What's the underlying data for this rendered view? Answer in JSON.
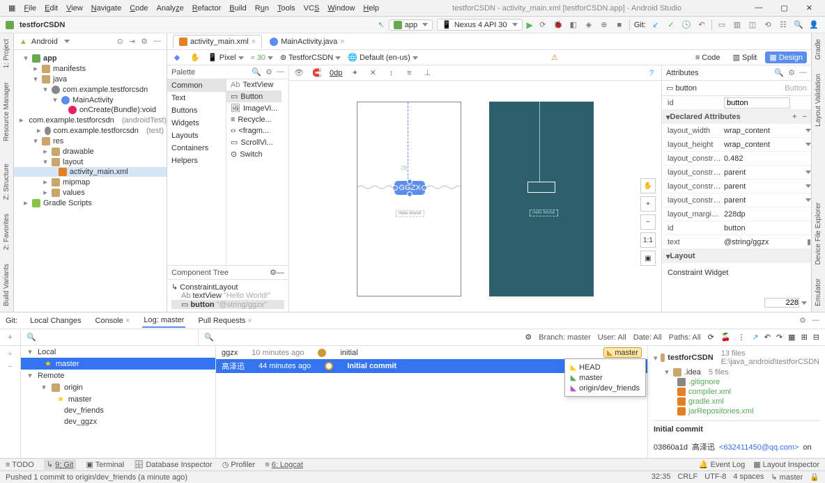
{
  "window": {
    "title": "testforCSDN - activity_main.xml [testforCSDN.app] - Android Studio",
    "menu": [
      "File",
      "Edit",
      "View",
      "Navigate",
      "Code",
      "Analyze",
      "Refactor",
      "Build",
      "Run",
      "Tools",
      "VCS",
      "Window",
      "Help"
    ]
  },
  "breadcrumb": "testforCSDN",
  "run_config": {
    "app": "app",
    "device": "Nexus 4 API 30",
    "git_label": "Git:"
  },
  "project_view": {
    "mode": "Android",
    "nodes": {
      "app": "app",
      "manifests": "manifests",
      "java": "java",
      "pkg1": "com.example.testforcsdn",
      "main_activity": "MainActivity",
      "on_create": "onCreate(Bundle):void",
      "pkg2": "com.example.testforcsdn",
      "pkg2_suffix": "(androidTest)",
      "pkg3": "com.example.testforcsdn",
      "pkg3_suffix": "(test)",
      "res": "res",
      "drawable": "drawable",
      "layout": "layout",
      "activity_main": "activity_main.xml",
      "mipmap": "mipmap",
      "values": "values",
      "gradle": "Gradle Scripts"
    }
  },
  "editor_tabs": {
    "t1": "activity_main.xml",
    "t2": "MainActivity.java"
  },
  "palette": {
    "title": "Palette",
    "cats": {
      "common": "Common",
      "text": "Text",
      "buttons": "Buttons",
      "widgets": "Widgets",
      "layouts": "Layouts",
      "containers": "Containers",
      "helpers": "Helpers"
    },
    "items": {
      "tv": "TextView",
      "btn": "Button",
      "iv": "ImageVi...",
      "rv": "Recycle...",
      "fr": "<fragm...",
      "sv": "ScrollVi...",
      "sw": "Switch"
    }
  },
  "comp_tree": {
    "title": "Component Tree",
    "root": "ConstraintLayout",
    "tv": "textView",
    "tv_text": "\"Hello World!\"",
    "btn": "button",
    "btn_text": "\"@string/ggzx\""
  },
  "design_toolbar": {
    "device": "Pixel",
    "api": "30",
    "theme": "TestforCSDN",
    "locale": "Default (en-us)",
    "code": "Code",
    "split": "Split",
    "design": "Design",
    "dp_label": "0dp"
  },
  "canvas": {
    "label": "GGZX",
    "tv_text": "Hello World!",
    "meas": "28",
    "z1": "+",
    "z2": "−",
    "z3": "1:1",
    "z228": "228"
  },
  "attributes": {
    "title": "Attributes",
    "component": "button",
    "class": "Button",
    "declared": "Declared Attributes",
    "rows": {
      "id_lbl": "id",
      "id_val": "button",
      "lw": "layout_width",
      "lw_v": "wrap_content",
      "lh": "layout_height",
      "lh_v": "wrap_content",
      "lc1": "layout_constrai...",
      "lc1_v": "0.482",
      "lc2": "layout_constrai...",
      "lc2_v": "parent",
      "lc3": "layout_constrai...",
      "lc3_v": "parent",
      "lc4": "layout_constrai...",
      "lc4_v": "parent",
      "lm": "layout_marginT...",
      "lm_v": "228dp",
      "id2": "id",
      "id2_v": "button",
      "text": "text",
      "text_v": "@string/ggzx"
    },
    "layout_sect": "Layout",
    "cw": "Constraint Widget"
  },
  "git_panel": {
    "label": "Git:",
    "tabs": {
      "lc": "Local Changes",
      "con": "Console",
      "log": "Log: master",
      "pr": "Pull Requests"
    },
    "branch_filter": "Branch: master",
    "user_filter": "User: All",
    "date_filter": "Date: All",
    "paths_filter": "Paths: All",
    "branches": {
      "local": "Local",
      "master": "master",
      "remote": "Remote",
      "origin": "origin",
      "r_master": "master",
      "dev_friends": "dev_friends",
      "dev_ggzx": "dev_ggzx"
    },
    "commits": {
      "c1_author": "ggzx",
      "c1_time": "10 minutes ago",
      "c1_msg": "initial",
      "c2_author": "高泽迅",
      "c2_time": "44 minutes ago",
      "c2_msg": "Initial commit",
      "tag": "master"
    },
    "popup": {
      "head": "HEAD",
      "master": "master",
      "odf": "origin/dev_friends"
    },
    "details": {
      "proj": "testforCSDN",
      "proj_meta": "13 files  E:\\java_android\\testforCSDN",
      "idea": ".idea",
      "idea_meta": "5 files",
      "f1": ".gitignore",
      "f2": "compiler.xml",
      "f3": "gradle.xml",
      "f4": "jarRepositories.xml",
      "commit_msg": "Initial commit",
      "hash": "03860a1d",
      "author": "高泽迅",
      "email": "<632411450@qq.com>",
      "on": "on"
    }
  },
  "bottom_tools": {
    "todo": "TODO",
    "git": "9: Git",
    "term": "Terminal",
    "db": "Database Inspector",
    "prof": "Profiler",
    "logcat": "6: Logcat",
    "evlog": "Event Log",
    "layins": "Layout Inspector"
  },
  "status": {
    "msg": "Pushed 1 commit to origin/dev_friends (a minute ago)",
    "pos": "32:35",
    "le": "CRLF",
    "enc": "UTF-8",
    "indent": "4 spaces",
    "branch": "master"
  },
  "side_tabs": {
    "l1": "1: Project",
    "l2": "Resource Manager",
    "l3": "Z: Structure",
    "l4": "2: Favorites",
    "l5": "Build Variants",
    "r1": "Gradle",
    "r2": "Layout Validation",
    "r3": "Device File Explorer",
    "r4": "Emulator"
  }
}
